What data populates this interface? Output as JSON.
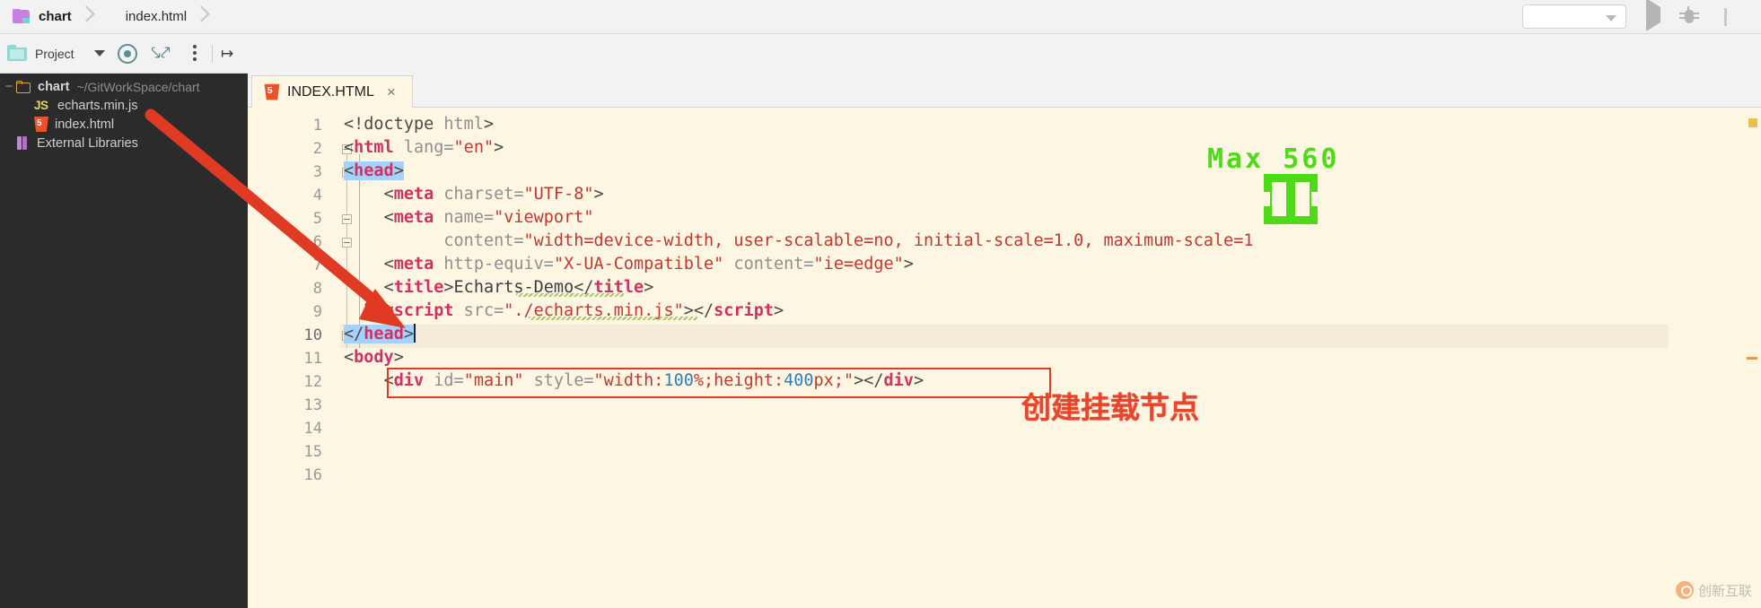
{
  "breadcrumb": {
    "project": "chart",
    "file": "index.html"
  },
  "toolbar": {
    "run_config_value": "",
    "run_label": "run-icon",
    "debug_label": "debug-icon"
  },
  "project_panel": {
    "title": "Project",
    "icons": [
      "target-icon",
      "collapse-all-icon",
      "more-options-icon",
      "hide-panel-icon"
    ],
    "tree": [
      {
        "name": "chart",
        "path": "~/GitWorkSpace/chart",
        "icon": "folder-icon",
        "depth": 0,
        "bold": true
      },
      {
        "name": "echarts.min.js",
        "path": "",
        "icon": "js-file-icon",
        "depth": 1,
        "bold": false
      },
      {
        "name": "index.html",
        "path": "",
        "icon": "html-file-icon",
        "depth": 1,
        "bold": false
      },
      {
        "name": "External Libraries",
        "path": "",
        "icon": "library-icon",
        "depth": 0,
        "bold": false
      }
    ]
  },
  "editor": {
    "tab": {
      "label": "INDEX.HTML",
      "close": "×",
      "icon": "html-file-icon"
    },
    "line_numbers": [
      "1",
      "2",
      "3",
      "4",
      "5",
      "6",
      "7",
      "8",
      "9",
      "10",
      "11",
      "12",
      "13",
      "14",
      "15",
      "16"
    ],
    "current_line": 10,
    "code_lines": [
      "<!doctype html>",
      "<html lang=\"en\">",
      "<head>",
      "    <meta charset=\"UTF-8\">",
      "    <meta name=\"viewport\"",
      "          content=\"width=device-width, user-scalable=no, initial-scale=1.0, maximum-scale=1",
      "    <meta http-equiv=\"X-UA-Compatible\" content=\"ie=edge\">",
      "    <title>Echarts-Demo</title>",
      "    <script src=\"./echarts.min.js\"></script>",
      "</head>",
      "<body>",
      "    <div id=\"main\" style=\"width:100%;height:400px;\"></div>",
      "",
      "",
      "",
      ""
    ]
  },
  "annotations": {
    "red_box_note": "创建挂载节点",
    "max_label": "Max 560",
    "arrow": "red-arrow-pointing-to-script-tag"
  },
  "watermark": {
    "text": "创新互联"
  },
  "colors": {
    "editor_bg": "#fdf6e3",
    "sidebar_bg": "#2b2b2b",
    "chrome_bg": "#f2f2f2",
    "tag": "#d32f60",
    "attr": "#8f8f8f",
    "value": "#c2382e",
    "number": "#2b7fbd",
    "selection": "#a6d2fa",
    "annotation_red": "#e03a25",
    "annotation_green": "#4ddb18"
  }
}
